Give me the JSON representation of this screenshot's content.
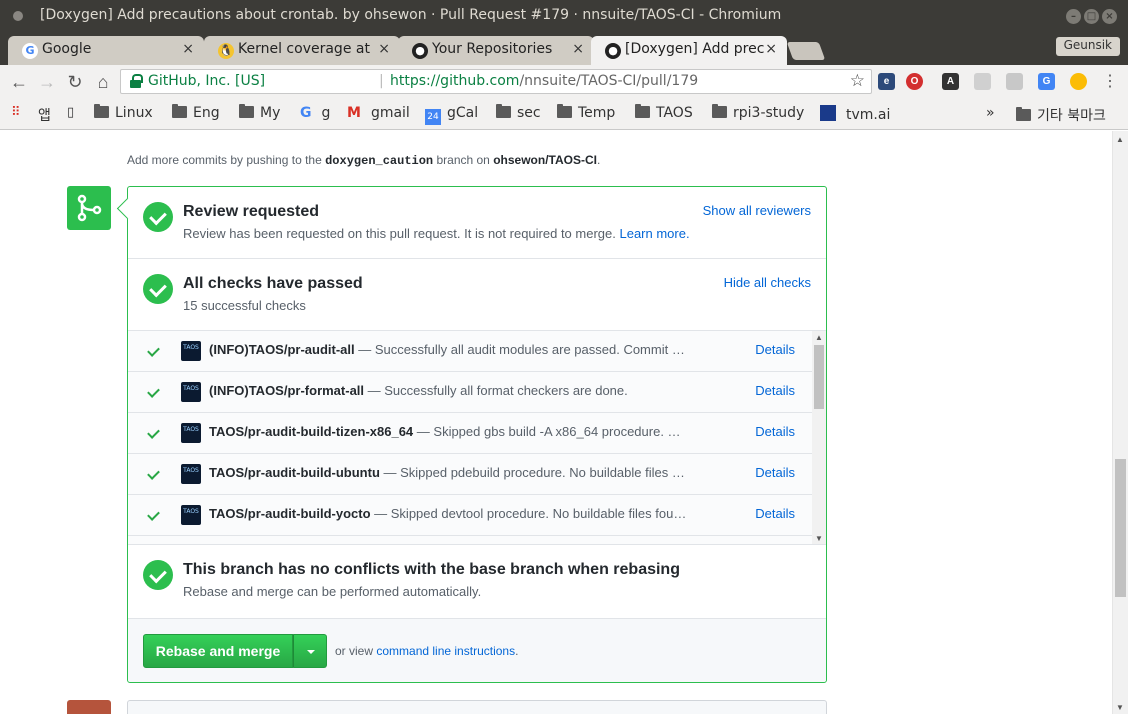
{
  "window": {
    "title": "[Doxygen] Add precautions about crontab. by ohsewon · Pull Request #179 · nnsuite/TAOS-CI - Chromium"
  },
  "tabs": [
    {
      "label": "Google",
      "close": "×"
    },
    {
      "label": "Kernel coverage at",
      "close": "×"
    },
    {
      "label": "Your Repositories",
      "close": "×"
    },
    {
      "label": "[Doxygen] Add prec",
      "close": "×"
    }
  ],
  "user_badge": "Geunsik",
  "omnibox": {
    "org": "GitHub, Inc. [US]",
    "separator": "|",
    "url_host": "https://github.com",
    "url_path": "/nnsuite/TAOS-CI/pull/179"
  },
  "bookmarks": {
    "apps": "앱",
    "items": [
      "Linux",
      "Eng",
      "My",
      "g",
      "gmail",
      "gCal",
      "sec",
      "Temp",
      "TAOS",
      "rpi3-study",
      "tvm.ai"
    ],
    "overflow": "»",
    "other": "기타 북마크",
    "gcal_day": "24"
  },
  "hint": {
    "prefix": "Add more commits by pushing to the",
    "branch": "doxygen_caution",
    "middle": "branch on",
    "repo": "ohsewon/TAOS-CI",
    "suffix": "."
  },
  "review": {
    "title": "Review requested",
    "desc": "Review has been requested on this pull request. It is not required to merge.",
    "learn_more": "Learn more.",
    "action": "Show all reviewers"
  },
  "checks": {
    "title": "All checks have passed",
    "desc": "15 successful checks",
    "action": "Hide all checks",
    "avatar_text": "TAOS",
    "details_label": "Details",
    "rows": [
      {
        "name": "(INFO)TAOS/pr-audit-all",
        "desc": " — Successfully all audit modules are passed. Commit …"
      },
      {
        "name": "(INFO)TAOS/pr-format-all",
        "desc": " — Successfully all format checkers are done."
      },
      {
        "name": "TAOS/pr-audit-build-tizen-x86_64",
        "desc": " — Skipped gbs build -A x86_64 procedure. …"
      },
      {
        "name": "TAOS/pr-audit-build-ubuntu",
        "desc": " — Skipped pdebuild procedure. No buildable files …"
      },
      {
        "name": "TAOS/pr-audit-build-yocto",
        "desc": " — Skipped devtool procedure. No buildable files fou…"
      }
    ]
  },
  "conflicts": {
    "title": "This branch has no conflicts with the base branch when rebasing",
    "desc": "Rebase and merge can be performed automatically."
  },
  "merge": {
    "button": "Rebase and merge",
    "alt_prefix": "or view",
    "alt_link": "command line instructions",
    "alt_suffix": "."
  },
  "colors": {
    "success": "#2cbe4e",
    "link": "#0366d6",
    "omnibox_secure": "#0b8043"
  }
}
